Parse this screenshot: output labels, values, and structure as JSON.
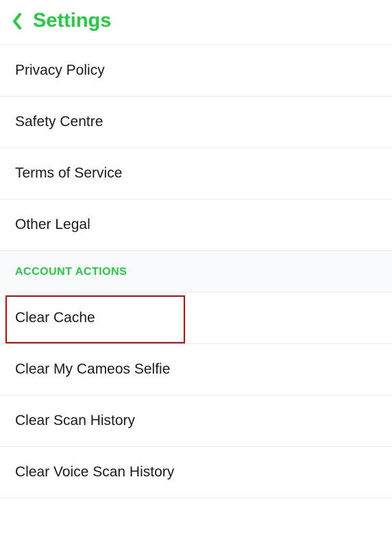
{
  "header": {
    "title": "Settings"
  },
  "legal_items": [
    "Privacy Policy",
    "Safety Centre",
    "Terms of Service",
    "Other Legal"
  ],
  "section_header": "ACCOUNT ACTIONS",
  "account_action_items": [
    "Clear Cache",
    "Clear My Cameos Selfie",
    "Clear Scan History",
    "Clear Voice Scan History"
  ]
}
